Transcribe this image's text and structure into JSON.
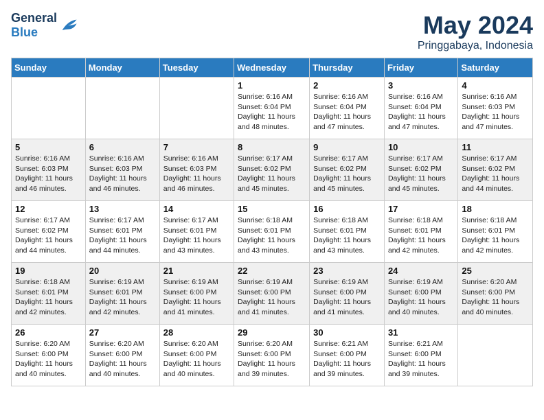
{
  "logo": {
    "general": "General",
    "blue": "Blue"
  },
  "title": "May 2024",
  "subtitle": "Pringgabaya, Indonesia",
  "days_header": [
    "Sunday",
    "Monday",
    "Tuesday",
    "Wednesday",
    "Thursday",
    "Friday",
    "Saturday"
  ],
  "weeks": [
    [
      {
        "num": "",
        "info": ""
      },
      {
        "num": "",
        "info": ""
      },
      {
        "num": "",
        "info": ""
      },
      {
        "num": "1",
        "info": "Sunrise: 6:16 AM\nSunset: 6:04 PM\nDaylight: 11 hours\nand 48 minutes."
      },
      {
        "num": "2",
        "info": "Sunrise: 6:16 AM\nSunset: 6:04 PM\nDaylight: 11 hours\nand 47 minutes."
      },
      {
        "num": "3",
        "info": "Sunrise: 6:16 AM\nSunset: 6:04 PM\nDaylight: 11 hours\nand 47 minutes."
      },
      {
        "num": "4",
        "info": "Sunrise: 6:16 AM\nSunset: 6:03 PM\nDaylight: 11 hours\nand 47 minutes."
      }
    ],
    [
      {
        "num": "5",
        "info": "Sunrise: 6:16 AM\nSunset: 6:03 PM\nDaylight: 11 hours\nand 46 minutes."
      },
      {
        "num": "6",
        "info": "Sunrise: 6:16 AM\nSunset: 6:03 PM\nDaylight: 11 hours\nand 46 minutes."
      },
      {
        "num": "7",
        "info": "Sunrise: 6:16 AM\nSunset: 6:03 PM\nDaylight: 11 hours\nand 46 minutes."
      },
      {
        "num": "8",
        "info": "Sunrise: 6:17 AM\nSunset: 6:02 PM\nDaylight: 11 hours\nand 45 minutes."
      },
      {
        "num": "9",
        "info": "Sunrise: 6:17 AM\nSunset: 6:02 PM\nDaylight: 11 hours\nand 45 minutes."
      },
      {
        "num": "10",
        "info": "Sunrise: 6:17 AM\nSunset: 6:02 PM\nDaylight: 11 hours\nand 45 minutes."
      },
      {
        "num": "11",
        "info": "Sunrise: 6:17 AM\nSunset: 6:02 PM\nDaylight: 11 hours\nand 44 minutes."
      }
    ],
    [
      {
        "num": "12",
        "info": "Sunrise: 6:17 AM\nSunset: 6:02 PM\nDaylight: 11 hours\nand 44 minutes."
      },
      {
        "num": "13",
        "info": "Sunrise: 6:17 AM\nSunset: 6:01 PM\nDaylight: 11 hours\nand 44 minutes."
      },
      {
        "num": "14",
        "info": "Sunrise: 6:17 AM\nSunset: 6:01 PM\nDaylight: 11 hours\nand 43 minutes."
      },
      {
        "num": "15",
        "info": "Sunrise: 6:18 AM\nSunset: 6:01 PM\nDaylight: 11 hours\nand 43 minutes."
      },
      {
        "num": "16",
        "info": "Sunrise: 6:18 AM\nSunset: 6:01 PM\nDaylight: 11 hours\nand 43 minutes."
      },
      {
        "num": "17",
        "info": "Sunrise: 6:18 AM\nSunset: 6:01 PM\nDaylight: 11 hours\nand 42 minutes."
      },
      {
        "num": "18",
        "info": "Sunrise: 6:18 AM\nSunset: 6:01 PM\nDaylight: 11 hours\nand 42 minutes."
      }
    ],
    [
      {
        "num": "19",
        "info": "Sunrise: 6:18 AM\nSunset: 6:01 PM\nDaylight: 11 hours\nand 42 minutes."
      },
      {
        "num": "20",
        "info": "Sunrise: 6:19 AM\nSunset: 6:01 PM\nDaylight: 11 hours\nand 42 minutes."
      },
      {
        "num": "21",
        "info": "Sunrise: 6:19 AM\nSunset: 6:00 PM\nDaylight: 11 hours\nand 41 minutes."
      },
      {
        "num": "22",
        "info": "Sunrise: 6:19 AM\nSunset: 6:00 PM\nDaylight: 11 hours\nand 41 minutes."
      },
      {
        "num": "23",
        "info": "Sunrise: 6:19 AM\nSunset: 6:00 PM\nDaylight: 11 hours\nand 41 minutes."
      },
      {
        "num": "24",
        "info": "Sunrise: 6:19 AM\nSunset: 6:00 PM\nDaylight: 11 hours\nand 40 minutes."
      },
      {
        "num": "25",
        "info": "Sunrise: 6:20 AM\nSunset: 6:00 PM\nDaylight: 11 hours\nand 40 minutes."
      }
    ],
    [
      {
        "num": "26",
        "info": "Sunrise: 6:20 AM\nSunset: 6:00 PM\nDaylight: 11 hours\nand 40 minutes."
      },
      {
        "num": "27",
        "info": "Sunrise: 6:20 AM\nSunset: 6:00 PM\nDaylight: 11 hours\nand 40 minutes."
      },
      {
        "num": "28",
        "info": "Sunrise: 6:20 AM\nSunset: 6:00 PM\nDaylight: 11 hours\nand 40 minutes."
      },
      {
        "num": "29",
        "info": "Sunrise: 6:20 AM\nSunset: 6:00 PM\nDaylight: 11 hours\nand 39 minutes."
      },
      {
        "num": "30",
        "info": "Sunrise: 6:21 AM\nSunset: 6:00 PM\nDaylight: 11 hours\nand 39 minutes."
      },
      {
        "num": "31",
        "info": "Sunrise: 6:21 AM\nSunset: 6:00 PM\nDaylight: 11 hours\nand 39 minutes."
      },
      {
        "num": "",
        "info": ""
      }
    ]
  ]
}
